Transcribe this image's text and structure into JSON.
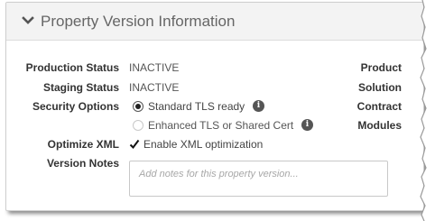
{
  "header": {
    "title": "Property Version Information",
    "chevron_icon": "chevron-down-icon"
  },
  "fields": {
    "production_status": {
      "label": "Production Status",
      "value": "INACTIVE"
    },
    "staging_status": {
      "label": "Staging Status",
      "value": "INACTIVE"
    },
    "security_options": {
      "label": "Security Options",
      "options": [
        {
          "label": "Standard TLS ready",
          "selected": true,
          "disabled": false
        },
        {
          "label": "Enhanced TLS or Shared Cert",
          "selected": false,
          "disabled": true
        }
      ]
    },
    "optimize_xml": {
      "label": "Optimize XML",
      "checkbox_label": "Enable XML optimization",
      "checked": true
    },
    "version_notes": {
      "label": "Version Notes",
      "placeholder": "Add notes for this property version...",
      "value": ""
    }
  },
  "right_column": {
    "product": "Product",
    "solution": "Solution",
    "contract": "Contract",
    "modules": "Modules"
  },
  "colors": {
    "header_bg": "#f3f3f3",
    "title_text": "#666666",
    "label_text": "#333333",
    "info_icon": "#555555"
  }
}
